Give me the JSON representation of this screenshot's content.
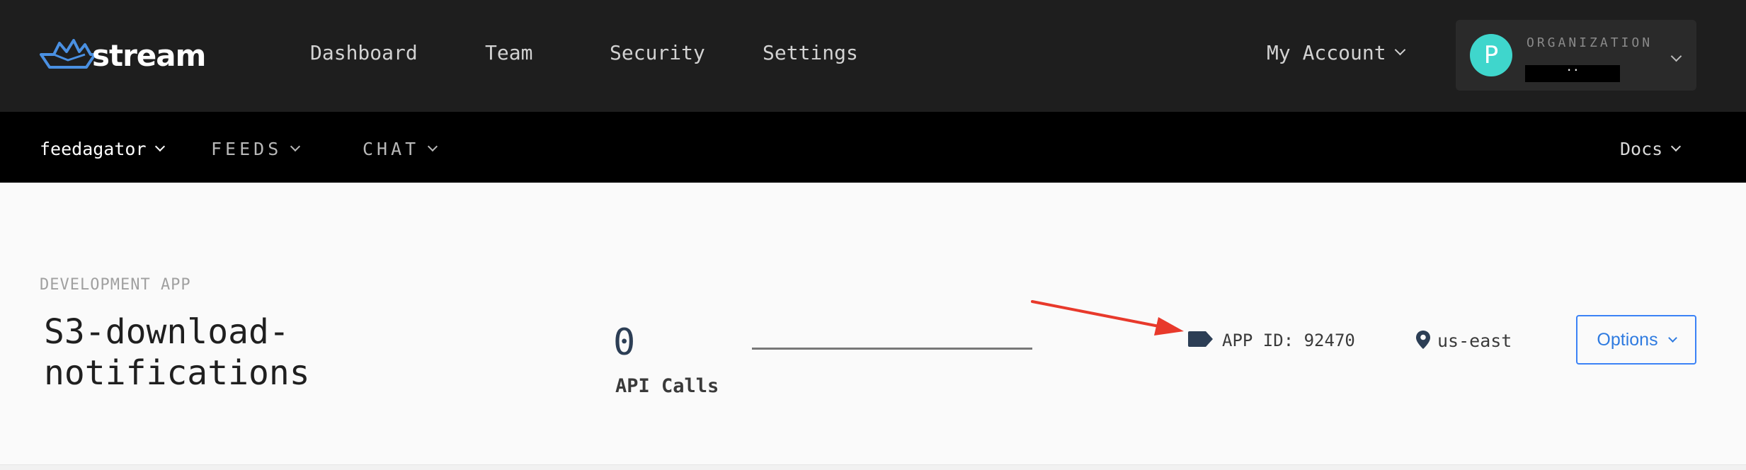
{
  "brand": {
    "name": "stream",
    "logo_icon": "boat-logo-icon",
    "accent": "#3b82f6"
  },
  "topnav": {
    "items": [
      {
        "label": "Dashboard"
      },
      {
        "label": "Team"
      },
      {
        "label": "Security"
      },
      {
        "label": "Settings"
      }
    ],
    "my_account": "My Account",
    "organization": {
      "label": "ORGANIZATION",
      "avatar_letter": "P",
      "name": "..",
      "avatar_color": "#3fd6cc"
    }
  },
  "subnav": {
    "app": "feedagator",
    "feeds": "FEEDS",
    "chat": "CHAT",
    "docs": "Docs"
  },
  "app": {
    "environment_label": "DEVELOPMENT APP",
    "title": "S3-download-notifications",
    "api_calls_value": "0",
    "api_calls_label": "API Calls",
    "app_id": "APP ID: 92470",
    "region": "us-east",
    "options_label": "Options"
  },
  "annotation": {
    "arrow_color": "#e8392b",
    "icon": "red-arrow-icon"
  }
}
